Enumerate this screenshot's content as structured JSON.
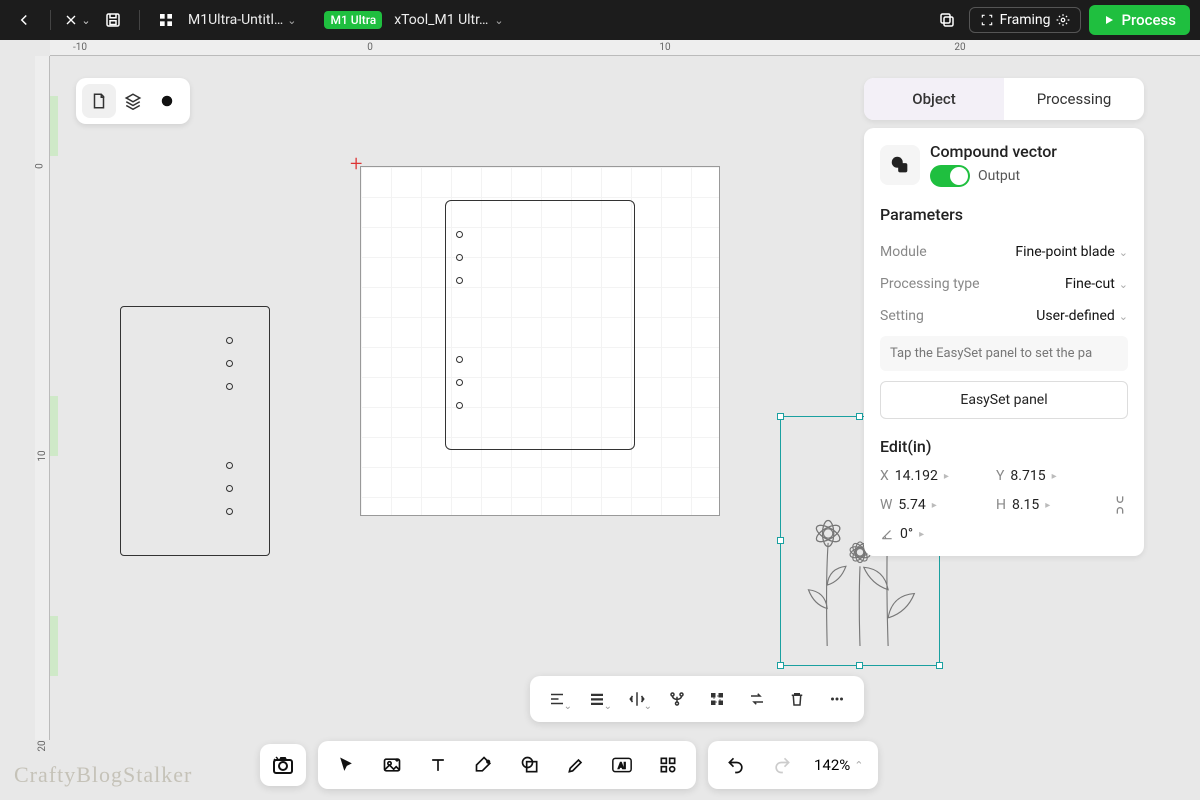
{
  "topbar": {
    "file_name": "M1Ultra-Untitl…",
    "device_badge": "M1 Ultra",
    "device_name": "xTool_M1 Ultr…",
    "framing_label": "Framing",
    "process_label": "Process"
  },
  "ruler_h": {
    "m10": "-10",
    "0": "0",
    "10": "10",
    "20": "20"
  },
  "ruler_v": {
    "0": "0",
    "10": "10",
    "20": "20"
  },
  "panel": {
    "tabs": {
      "object": "Object",
      "processing": "Processing"
    },
    "compound_vector": "Compound vector",
    "output_label": "Output",
    "parameters": "Parameters",
    "module_label": "Module",
    "module_value": "Fine-point blade",
    "ptype_label": "Processing type",
    "ptype_value": "Fine-cut",
    "setting_label": "Setting",
    "setting_value": "User-defined",
    "hint": "Tap the EasySet panel to set the pa",
    "easyset": "EasySet panel",
    "edit_title": "Edit(in)",
    "x_label": "X",
    "x_value": "14.192",
    "y_label": "Y",
    "y_value": "8.715",
    "w_label": "W",
    "w_value": "5.74",
    "h_label": "H",
    "h_value": "8.15",
    "angle_value": "0°"
  },
  "zoom": {
    "value": "142%"
  },
  "watermark": "CraftyBlogStalker"
}
